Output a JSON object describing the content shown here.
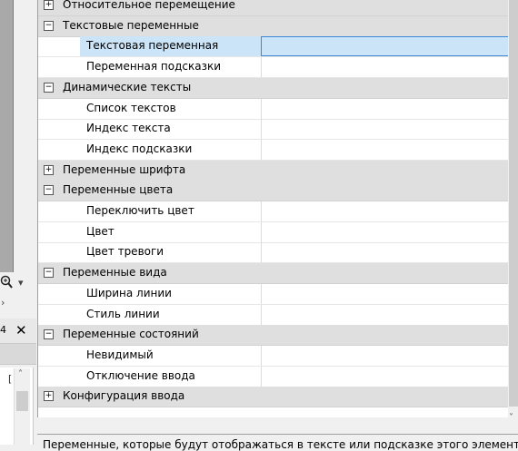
{
  "left_panel": {
    "tab_fragment": "4",
    "pane_fragment": "["
  },
  "property_grid": {
    "rows": [
      {
        "kind": "cat",
        "label": "Относительное перемещение",
        "toggle": "+"
      },
      {
        "kind": "cat",
        "label": "Текстовые переменные",
        "toggle": "−"
      },
      {
        "kind": "prop",
        "label": "Текстовая переменная",
        "selected": true
      },
      {
        "kind": "prop",
        "label": "Переменная подсказки"
      },
      {
        "kind": "cat",
        "label": "Динамические тексты",
        "toggle": "−"
      },
      {
        "kind": "prop",
        "label": "Список текстов"
      },
      {
        "kind": "prop",
        "label": "Индекс текста"
      },
      {
        "kind": "prop",
        "label": "Индекс подсказки"
      },
      {
        "kind": "cat",
        "label": "Переменные шрифта",
        "toggle": "+"
      },
      {
        "kind": "cat",
        "label": "Переменные цвета",
        "toggle": "−"
      },
      {
        "kind": "prop",
        "label": "Переключить цвет"
      },
      {
        "kind": "prop",
        "label": "Цвет"
      },
      {
        "kind": "prop",
        "label": "Цвет тревоги"
      },
      {
        "kind": "cat",
        "label": "Переменные вида",
        "toggle": "−"
      },
      {
        "kind": "prop",
        "label": "Ширина линии"
      },
      {
        "kind": "prop",
        "label": "Стиль линии"
      },
      {
        "kind": "cat",
        "label": "Переменные состояний",
        "toggle": "−"
      },
      {
        "kind": "prop",
        "label": "Невидимый"
      },
      {
        "kind": "prop",
        "label": "Отключение ввода"
      },
      {
        "kind": "cat",
        "label": "Конфигурация ввода",
        "toggle": "+"
      }
    ]
  },
  "description": {
    "text": "Переменные, которые будут отображаться в тексте или подсказке этого элемента"
  },
  "icons": {
    "zoom": "zoom-icon",
    "close": "close-icon",
    "scroll_down": "chevron-down-icon"
  }
}
